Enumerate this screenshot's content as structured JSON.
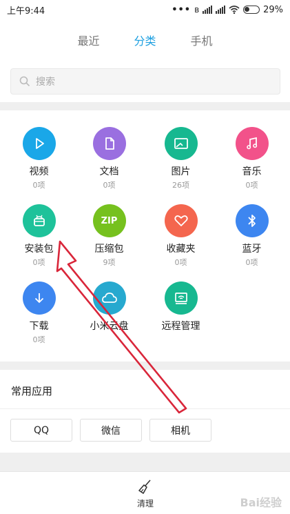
{
  "status": {
    "time": "上午9:44",
    "battery": "29%"
  },
  "tabs": [
    {
      "label": "最近"
    },
    {
      "label": "分类"
    },
    {
      "label": "手机"
    }
  ],
  "search": {
    "placeholder": "搜索"
  },
  "categories": [
    {
      "label": "视频",
      "count": "0项",
      "icon": "play-icon",
      "color": "#1aa7e8"
    },
    {
      "label": "文档",
      "count": "0项",
      "icon": "document-icon",
      "color": "#9a6fe0"
    },
    {
      "label": "图片",
      "count": "26项",
      "icon": "image-icon",
      "color": "#17b890"
    },
    {
      "label": "音乐",
      "count": "0项",
      "icon": "music-icon",
      "color": "#f2528a"
    },
    {
      "label": "安装包",
      "count": "0项",
      "icon": "android-icon",
      "color": "#1ec29a"
    },
    {
      "label": "压缩包",
      "count": "9项",
      "icon": "zip-icon",
      "color": "#76c11e",
      "icon_text": "ZIP"
    },
    {
      "label": "收藏夹",
      "count": "0项",
      "icon": "heart-icon",
      "color": "#f4664e"
    },
    {
      "label": "蓝牙",
      "count": "0项",
      "icon": "bluetooth-icon",
      "color": "#3d86f0"
    },
    {
      "label": "下载",
      "count": "0项",
      "icon": "download-icon",
      "color": "#3d86f0"
    },
    {
      "label": "小米云盘",
      "icon": "cloud-icon",
      "color": "#27a9cf"
    },
    {
      "label": "远程管理",
      "icon": "wifi-monitor-icon",
      "color": "#17b890"
    }
  ],
  "apps": {
    "title": "常用应用",
    "items": [
      "QQ",
      "微信",
      "相机"
    ]
  },
  "bottom": {
    "clean_label": "清理"
  },
  "watermark": "Bai经验"
}
